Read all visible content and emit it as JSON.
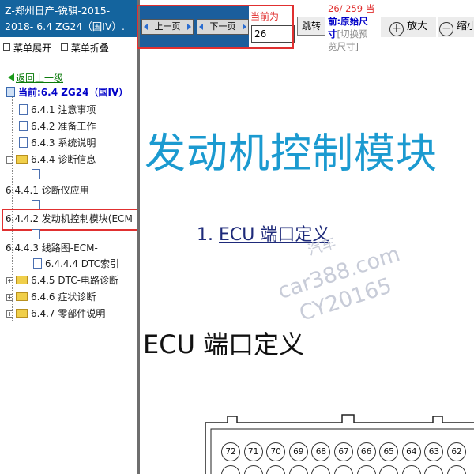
{
  "sidebar": {
    "title_line1": "Z-郑州日产-锐骐-2015-",
    "title_line2": "2018- 6.4 ZG24（国IV）.",
    "menu_expand": "菜单展开",
    "menu_collapse": "菜单折叠",
    "back_label": "返回上一级",
    "current_label": "当前:6.4 ZG24（国IV）",
    "items": [
      {
        "label": "6.4.1 注意事项"
      },
      {
        "label": "6.4.2 准备工作"
      },
      {
        "label": "6.4.3 系统说明"
      },
      {
        "label": "6.4.4 诊断信息"
      },
      {
        "label": "6.4.4.1 诊断仪应用"
      },
      {
        "label": "6.4.4.2 发动机控制模块(ECM"
      },
      {
        "label": "6.4.4.3 线路图-ECM-"
      },
      {
        "label": "6.4.4.4 DTC索引"
      },
      {
        "label": "6.4.5 DTC-电路诊断"
      },
      {
        "label": "6.4.6 症状诊断"
      },
      {
        "label": "6.4.7 零部件说明"
      }
    ]
  },
  "toolbar": {
    "prev_page": "上一页",
    "next_page": "下一页",
    "current_label": "当前为",
    "page_input_value": "26",
    "jump_button": "跳转",
    "page_status_1": "26/ 259 当",
    "page_status_2a": "前:",
    "page_status_2b": "原始尺",
    "page_status_3a": "寸",
    "page_status_3b": "[切换预",
    "page_status_4": "览尺寸]",
    "zoom_in": "放大",
    "zoom_out": "缩小"
  },
  "content": {
    "big_title": "发动机控制模块",
    "link_number": "1.",
    "link_text": "ECU 端口定义",
    "section_heading": "ECU 端口定义",
    "watermark_1": "car388.com",
    "watermark_2": "CY20165",
    "watermark_3": "汽车",
    "pins_row1": [
      "72",
      "71",
      "70",
      "69",
      "68",
      "67",
      "66",
      "65",
      "64",
      "63",
      "62"
    ]
  },
  "colors": {
    "title_bg": "#14649e",
    "highlight_red": "#e03030",
    "big_title": "#1b9ad0",
    "current_blue": "#0000c8"
  }
}
